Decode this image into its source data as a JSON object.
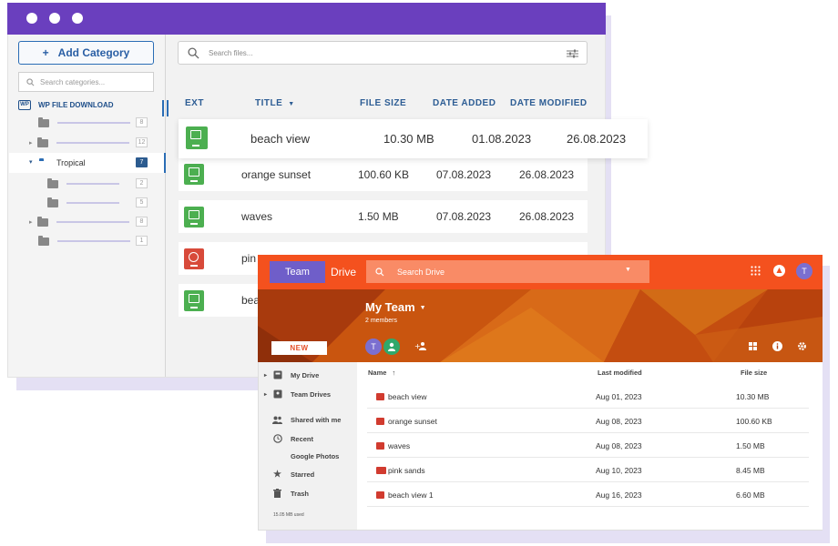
{
  "wp_window": {
    "add_category_label": "Add Category",
    "search_categories_placeholder": "Search categories...",
    "root_label": "WP FILE DOWNLOAD",
    "root_badge": "WP",
    "tree": [
      {
        "count": "8"
      },
      {
        "count": "12"
      },
      {
        "label": "Tropical",
        "count": "7"
      },
      {
        "count": "2"
      },
      {
        "count": "5"
      },
      {
        "count": "8"
      },
      {
        "count": "1"
      }
    ],
    "search_files_placeholder": "Search files...",
    "columns": {
      "ext": "EXT",
      "title": "TITLE",
      "file_size": "FILE SIZE",
      "date_added": "DATE ADDED",
      "date_modified": "DATE MODIFIED"
    },
    "files": [
      {
        "title": "beach view",
        "size": "10.30 MB",
        "added": "01.08.2023",
        "modified": "26.08.2023",
        "icon": "image-file-icon",
        "color": "#4caf50"
      },
      {
        "title": "orange sunset",
        "size": "100.60 KB",
        "added": "07.08.2023",
        "modified": "26.08.2023",
        "icon": "image-file-icon",
        "color": "#4caf50"
      },
      {
        "title": "waves",
        "size": "1.50 MB",
        "added": "07.08.2023",
        "modified": "26.08.2023",
        "icon": "image-file-icon",
        "color": "#4caf50"
      },
      {
        "title": "pin",
        "icon": "video-file-icon",
        "color": "#d84a3a"
      },
      {
        "title": "bea",
        "icon": "image-file-icon",
        "color": "#4caf50"
      }
    ]
  },
  "drive_window": {
    "team_label": "Team",
    "drive_label": "Drive",
    "search_placeholder": "Search Drive",
    "user_initial": "T",
    "title": "My Team",
    "members": "2 members",
    "new_label": "NEW",
    "nav": [
      {
        "label": "My Drive",
        "icon": "my-drive-icon"
      },
      {
        "label": "Team Drives",
        "icon": "team-drives-icon"
      },
      {
        "label": "Shared with me",
        "icon": "people-icon"
      },
      {
        "label": "Recent",
        "icon": "clock-icon"
      },
      {
        "label": "Google Photos",
        "icon": "photos-icon"
      },
      {
        "label": "Starred",
        "icon": "star-icon"
      },
      {
        "label": "Trash",
        "icon": "trash-icon"
      }
    ],
    "storage_used": "15.05 MB used",
    "columns": {
      "name": "Name",
      "last_modified": "Last modified",
      "file_size": "File size"
    },
    "files": [
      {
        "name": "beach view",
        "modified": "Aug 01, 2023",
        "size": "10.30 MB"
      },
      {
        "name": "orange sunset",
        "modified": "Aug 08, 2023",
        "size": "100.60 KB"
      },
      {
        "name": "waves",
        "modified": "Aug 08, 2023",
        "size": "1.50 MB"
      },
      {
        "name": "pink sands",
        "modified": "Aug 10, 2023",
        "size": "8.45 MB"
      },
      {
        "name": "beach view 1",
        "modified": "Aug 16, 2023",
        "size": "6.60 MB"
      }
    ],
    "colors": {
      "accent": "#f4511e",
      "team": "#6f5ec9",
      "avatar1": "#7b6fd0",
      "avatar2": "#2fa86b"
    }
  }
}
